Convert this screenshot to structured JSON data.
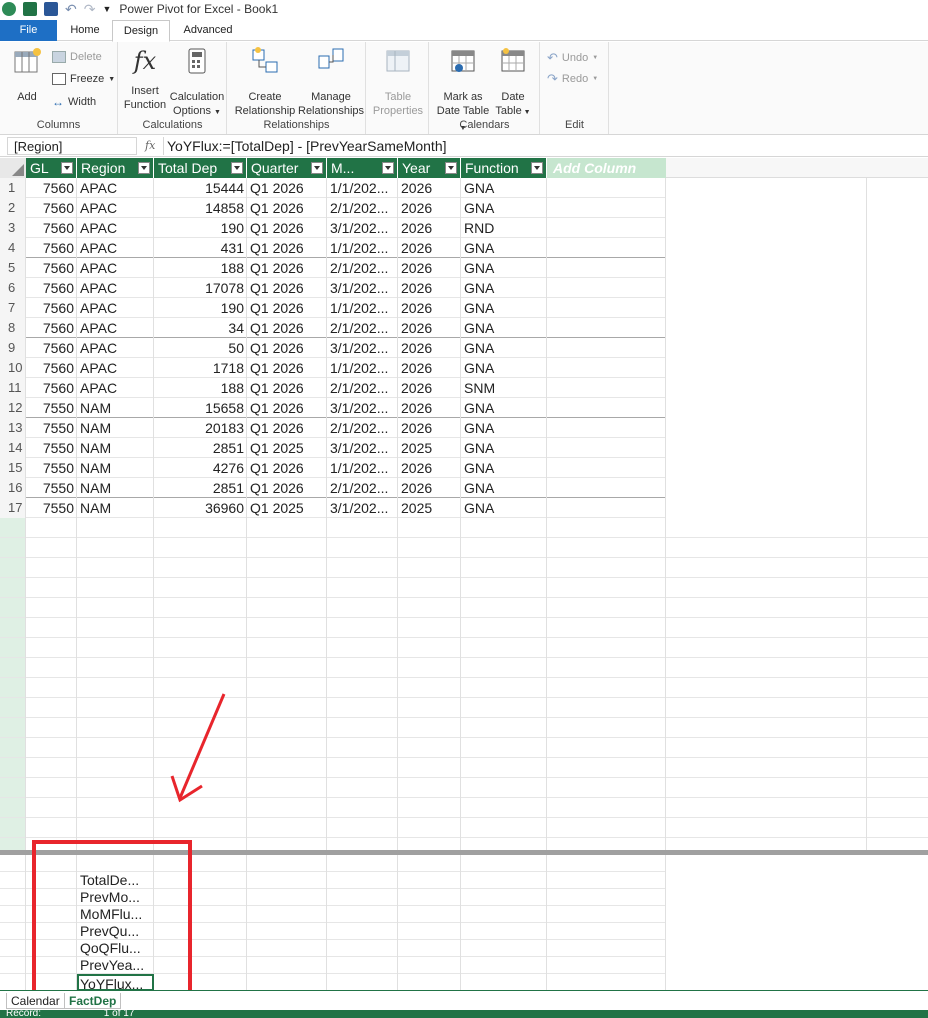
{
  "window": {
    "title": "Power Pivot for Excel - Book1"
  },
  "tabs": [
    "File",
    "Home",
    "Design",
    "Advanced"
  ],
  "ribbon": {
    "columns": {
      "add": "Add",
      "delete": "Delete",
      "freeze": "Freeze",
      "width": "Width",
      "group": "Columns"
    },
    "calculations": {
      "insert_function_1": "Insert",
      "insert_function_2": "Function",
      "calc_options_1": "Calculation",
      "calc_options_2": "Options",
      "group": "Calculations"
    },
    "relationships": {
      "create_1": "Create",
      "create_2": "Relationship",
      "manage_1": "Manage",
      "manage_2": "Relationships",
      "group": "Relationships"
    },
    "table_properties": {
      "line1": "Table",
      "line2": "Properties"
    },
    "calendars": {
      "mark_1": "Mark as",
      "mark_2": "Date Table",
      "date_1": "Date",
      "date_2": "Table",
      "group": "Calendars"
    },
    "edit": {
      "undo": "Undo",
      "redo": "Redo",
      "group": "Edit"
    }
  },
  "formula_bar": {
    "name_box": "[Region]",
    "fx": "fx",
    "formula": "YoYFlux:=[TotalDep] - [PrevYearSameMonth]"
  },
  "columns": [
    "GL",
    "Region",
    "Total Dep",
    "Quarter",
    "M...",
    "Year",
    "Function",
    "Add Column"
  ],
  "rows": [
    [
      "1",
      "7560",
      "APAC",
      "15444",
      "Q1 2026",
      "1/1/202...",
      "2026",
      "GNA"
    ],
    [
      "2",
      "7560",
      "APAC",
      "14858",
      "Q1 2026",
      "2/1/202...",
      "2026",
      "GNA"
    ],
    [
      "3",
      "7560",
      "APAC",
      "190",
      "Q1 2026",
      "3/1/202...",
      "2026",
      "RND"
    ],
    [
      "4",
      "7560",
      "APAC",
      "431",
      "Q1 2026",
      "1/1/202...",
      "2026",
      "GNA"
    ],
    [
      "5",
      "7560",
      "APAC",
      "188",
      "Q1 2026",
      "2/1/202...",
      "2026",
      "GNA"
    ],
    [
      "6",
      "7560",
      "APAC",
      "17078",
      "Q1 2026",
      "3/1/202...",
      "2026",
      "GNA"
    ],
    [
      "7",
      "7560",
      "APAC",
      "190",
      "Q1 2026",
      "1/1/202...",
      "2026",
      "GNA"
    ],
    [
      "8",
      "7560",
      "APAC",
      "34",
      "Q1 2026",
      "2/1/202...",
      "2026",
      "GNA"
    ],
    [
      "9",
      "7560",
      "APAC",
      "50",
      "Q1 2026",
      "3/1/202...",
      "2026",
      "GNA"
    ],
    [
      "10",
      "7560",
      "APAC",
      "1718",
      "Q1 2026",
      "1/1/202...",
      "2026",
      "GNA"
    ],
    [
      "11",
      "7560",
      "APAC",
      "188",
      "Q1 2026",
      "2/1/202...",
      "2026",
      "SNM"
    ],
    [
      "12",
      "7550",
      "NAM",
      "15658",
      "Q1 2026",
      "3/1/202...",
      "2026",
      "GNA"
    ],
    [
      "13",
      "7550",
      "NAM",
      "20183",
      "Q1 2026",
      "2/1/202...",
      "2026",
      "GNA"
    ],
    [
      "14",
      "7550",
      "NAM",
      "2851",
      "Q1 2025",
      "3/1/202...",
      "2025",
      "GNA"
    ],
    [
      "15",
      "7550",
      "NAM",
      "4276",
      "Q1 2026",
      "1/1/202...",
      "2026",
      "GNA"
    ],
    [
      "16",
      "7550",
      "NAM",
      "2851",
      "Q1 2026",
      "2/1/202...",
      "2026",
      "GNA"
    ],
    [
      "17",
      "7550",
      "NAM",
      "36960",
      "Q1 2025",
      "3/1/202...",
      "2025",
      "GNA"
    ]
  ],
  "measures": [
    "TotalDe...",
    "PrevMo...",
    "MoMFlu...",
    "PrevQu...",
    "QoQFlu...",
    "PrevYea...",
    "YoYFlux..."
  ],
  "sheet_tabs": [
    "Calendar",
    "FactDep"
  ],
  "status": {
    "record_label": "Record:",
    "record_value": "1 of 17"
  },
  "colors": {
    "accent": "#217346",
    "file_tab": "#1e6fc5",
    "annotation": "#e8252c"
  }
}
